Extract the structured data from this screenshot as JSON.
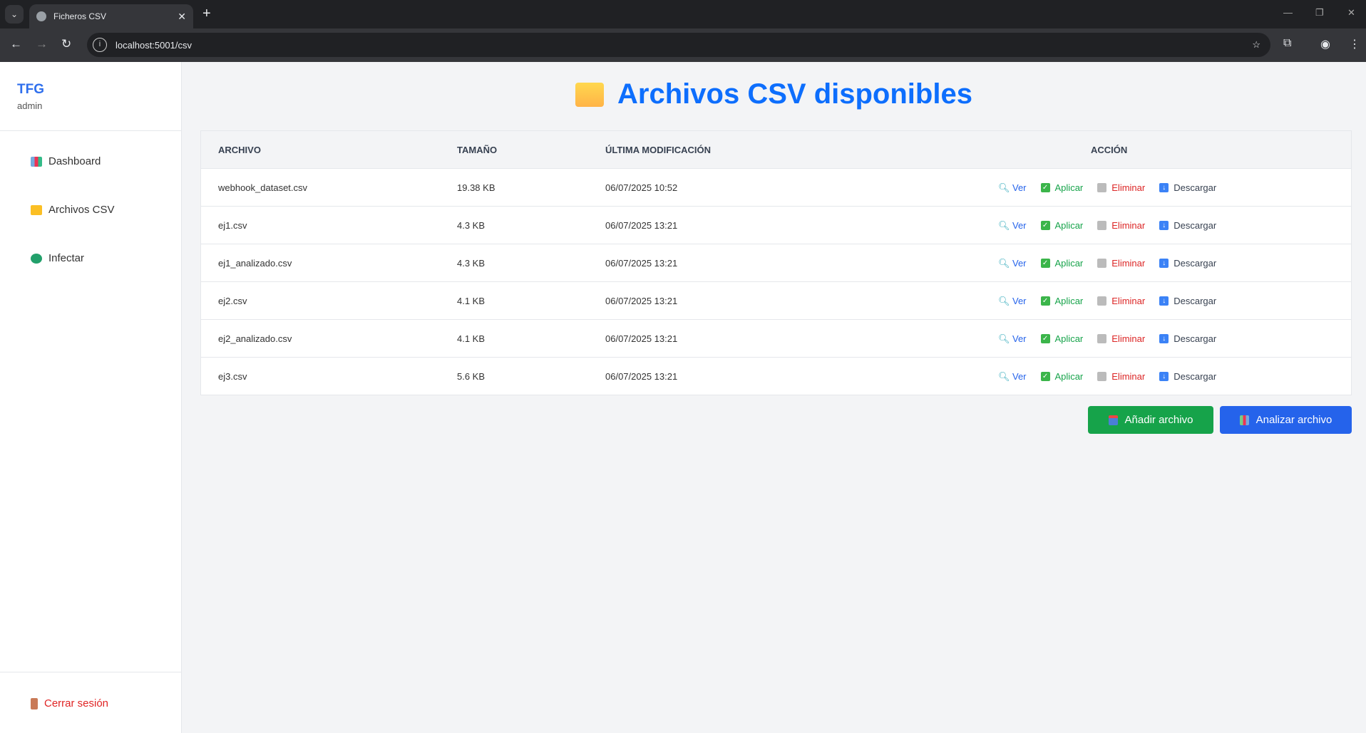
{
  "browser": {
    "tab_title": "Ficheros CSV",
    "url": "localhost:5001/csv"
  },
  "sidebar": {
    "brand": "TFG",
    "user": "admin",
    "items": [
      {
        "label": "Dashboard",
        "icon": "chart-icon"
      },
      {
        "label": "Archivos CSV",
        "icon": "folder-icon"
      },
      {
        "label": "Infectar",
        "icon": "virus-icon"
      }
    ],
    "logout": "Cerrar sesión"
  },
  "main": {
    "title": "Archivos CSV disponibles",
    "columns": [
      "ARCHIVO",
      "TAMAÑO",
      "ÚLTIMA MODIFICACIÓN",
      "ACCIÓN"
    ],
    "actions": {
      "view": "Ver",
      "apply": "Aplicar",
      "delete": "Eliminar",
      "download": "Descargar"
    },
    "rows": [
      {
        "name": "webhook_dataset.csv",
        "size": "19.38 KB",
        "modified": "06/07/2025 10:52"
      },
      {
        "name": "ej1.csv",
        "size": "4.3 KB",
        "modified": "06/07/2025 13:21"
      },
      {
        "name": "ej1_analizado.csv",
        "size": "4.3 KB",
        "modified": "06/07/2025 13:21"
      },
      {
        "name": "ej2.csv",
        "size": "4.1 KB",
        "modified": "06/07/2025 13:21"
      },
      {
        "name": "ej2_analizado.csv",
        "size": "4.1 KB",
        "modified": "06/07/2025 13:21"
      },
      {
        "name": "ej3.csv",
        "size": "5.6 KB",
        "modified": "06/07/2025 13:21"
      }
    ],
    "add_button": "Añadir archivo",
    "analyze_button": "Analizar archivo"
  },
  "colors": {
    "primary": "#0d6efd",
    "success": "#16a34a",
    "danger": "#dc2626",
    "analyze": "#2563eb"
  }
}
